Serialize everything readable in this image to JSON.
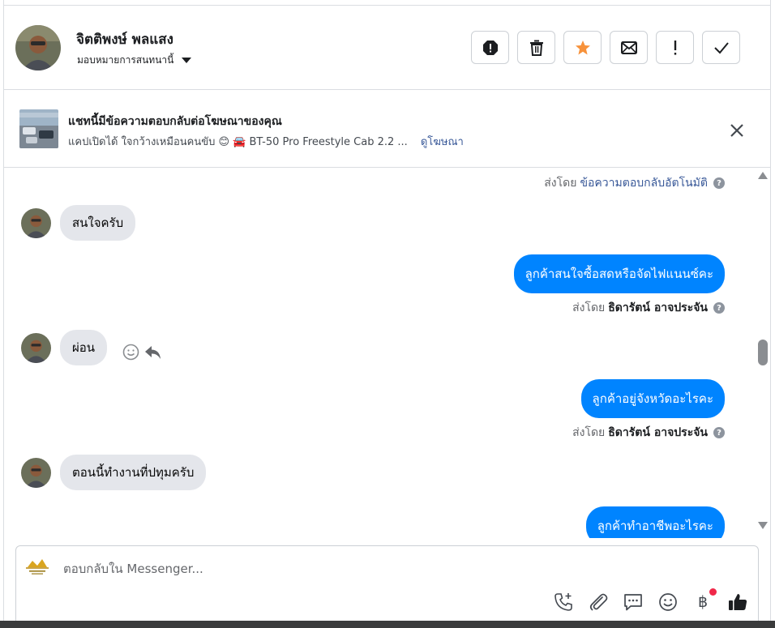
{
  "header": {
    "contact_name": "จิตติพงษ์ พลแสง",
    "assign_label": "มอบหมายการสนทนานี้",
    "actions": [
      {
        "name": "spam-icon"
      },
      {
        "name": "trash-icon"
      },
      {
        "name": "star-icon",
        "color": "#f7923b"
      },
      {
        "name": "envelope-icon"
      },
      {
        "name": "exclamation-icon"
      },
      {
        "name": "checkmark-icon"
      }
    ]
  },
  "ad_banner": {
    "title": "แชทนี้มีข้อความตอบกลับต่อโฆษณาของคุณ",
    "subtitle": "แคปเปิดได้ ใจกว้างเหมือนคนขับ 😊  🚘  BT-50 Pro Freestyle Cab 2.2 ...",
    "link": "ดูโฆษณา"
  },
  "thread": {
    "messages": [
      {
        "direction": "out-meta",
        "prefix": "ส่งโดย",
        "sender": "ข้อความตอบกลับอัตโนมัติ"
      },
      {
        "direction": "in",
        "text": "สนใจครับ"
      },
      {
        "direction": "out",
        "text": "ลูกค้าสนใจซื้อสดหรือจัดไฟแนนซ์คะ",
        "prefix": "ส่งโดย",
        "sender": "ธิดารัตน์ อาจประจัน"
      },
      {
        "direction": "in",
        "text": "ผ่อน"
      },
      {
        "direction": "out",
        "text": "ลูกค้าอยู่จังหวัดอะไรคะ",
        "prefix": "ส่งโดย",
        "sender": "ธิดารัตน์ อาจประจัน"
      },
      {
        "direction": "in",
        "text": "ตอนนี้ทำงานที่ปทุมครับ"
      },
      {
        "direction": "out",
        "text": "ลูกค้าทำอาชีพอะไรคะ"
      }
    ],
    "help_symbol": "?"
  },
  "composer": {
    "placeholder": "ตอบกลับใน Messenger...",
    "tools": [
      "phone-add-icon",
      "attachment-icon",
      "saved-reply-icon",
      "emoji-icon",
      "baht-payment-icon",
      "like-icon"
    ],
    "baht_symbol": "฿",
    "brand_color": "#0084ff"
  }
}
